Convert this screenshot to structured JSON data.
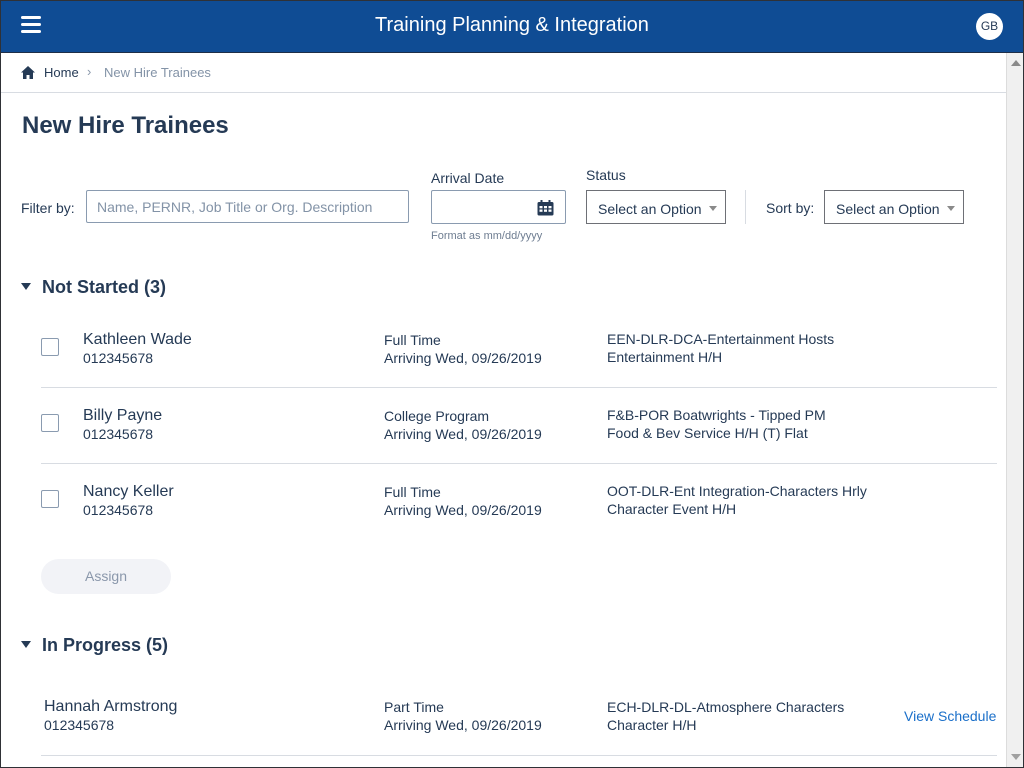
{
  "header": {
    "menu_icon": "hamburger-menu-icon",
    "title": "Training Planning & Integration",
    "avatar_initials": "GB"
  },
  "breadcrumb": {
    "home_icon": "home-icon",
    "home": "Home",
    "separator": "›",
    "current": "New Hire Trainees"
  },
  "page": {
    "title": "New Hire Trainees"
  },
  "filters": {
    "filter_label": "Filter by:",
    "filter_value": "",
    "filter_placeholder": "Name, PERNR, Job Title or Org. Description",
    "arrival_label": "Arrival Date",
    "arrival_value": "",
    "arrival_icon": "calendar-icon",
    "arrival_hint": "Format as mm/dd/yyyy",
    "status_label": "Status",
    "status_selected": "Select an Option",
    "sort_label": "Sort by:",
    "sort_selected": "Select an Option"
  },
  "sections": {
    "not_started": {
      "title": "Not Started (3)",
      "expanded": true,
      "assign_label": "Assign",
      "rows": [
        {
          "name": "Kathleen Wade",
          "id": "012345678",
          "type": "Full Time",
          "arrival": "Arriving Wed, 09/26/2019",
          "org": "EEN-DLR-DCA-Entertainment Hosts",
          "job": "Entertainment H/H",
          "checked": false
        },
        {
          "name": "Billy Payne",
          "id": "012345678",
          "type": "College Program",
          "arrival": "Arriving Wed, 09/26/2019",
          "org": "F&B-POR Boatwrights - Tipped PM",
          "job": "Food & Bev Service H/H (T) Flat",
          "checked": false
        },
        {
          "name": "Nancy Keller",
          "id": "012345678",
          "type": "Full Time",
          "arrival": "Arriving Wed, 09/26/2019",
          "org": "OOT-DLR-Ent Integration-Characters Hrly",
          "job": "Character Event H/H",
          "checked": false
        }
      ]
    },
    "in_progress": {
      "title": "In Progress (5)",
      "expanded": true,
      "rows": [
        {
          "name": "Hannah Armstrong",
          "id": "012345678",
          "type": "Part Time",
          "arrival": "Arriving Wed, 09/26/2019",
          "org": "ECH-DLR-DL-Atmosphere Characters",
          "job": "Character H/H",
          "action": "View Schedule"
        }
      ]
    }
  },
  "colors": {
    "brand": "#0f4c94",
    "text": "#253a55",
    "link": "#1a6fc9",
    "muted": "#8393a7"
  }
}
